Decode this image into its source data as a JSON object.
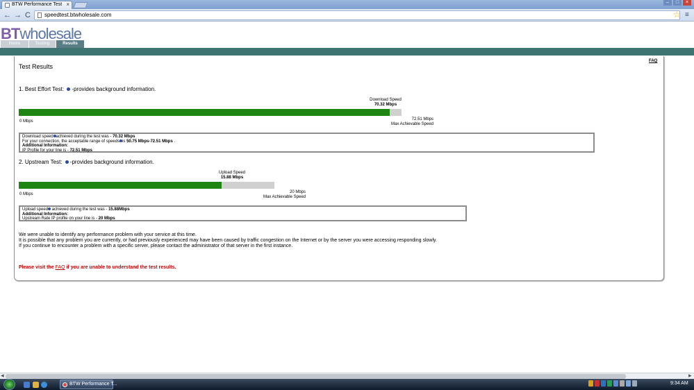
{
  "browser": {
    "tab_title": "BTW Performance Test",
    "tab_close": "×",
    "url": "speedtest.btwholesale.com",
    "back": "←",
    "forward": "→",
    "reload": "C",
    "star": "☆",
    "wrench": "≡",
    "win_buttons": [
      "–",
      "□",
      "×"
    ]
  },
  "site": {
    "logo_bt": "BT",
    "logo_wholesale": "wholesale",
    "tabs": [
      "Home",
      "Testing",
      "Results"
    ],
    "faq_link": "FAQ"
  },
  "results": {
    "title": "Test Results",
    "best_effort": {
      "heading_prefix": "1. Best Effort Test:",
      "heading_suffix": "-provides background information.",
      "speed_caption": "Download Speed",
      "speed_value": "70.32 Mbps",
      "zero_label": "0 Mbps",
      "max_value": "72.51 Mbps",
      "max_caption": "Max Achievable Speed",
      "fraction": 0.9698,
      "info_line1_prefix": "Download speed",
      "info_line1_mid": "achieved during the test was - ",
      "info_line1_value": "70.32 Mbps",
      "info_line2_prefix": "For your connection, the acceptable range of speeds",
      "info_line2_mid": "is ",
      "info_line2_value": "50.75 Mbps-72.51 Mbps",
      "info_line2_suffix": " .",
      "info_line3": "Additional Information:",
      "info_line4_prefix": "IP Profile for your line is - ",
      "info_line4_value": "72.51 Mbps"
    },
    "upstream": {
      "heading_prefix": "2. Upstream Test:",
      "heading_suffix": "-provides background information.",
      "speed_caption": "Upload Speed",
      "speed_value": "15.88 Mbps",
      "zero_label": "0 Mbps",
      "max_value": "20 Mbps",
      "max_caption": "Max Achievable Speed",
      "fraction": 0.794,
      "info_line1_prefix": "Upload speed",
      "info_line1_mid": " achieved during the test was - ",
      "info_line1_value": "15.88Mbps",
      "info_line2": "Additional Information:",
      "info_line3_prefix": "Upstream Rate IP profile on your line is - ",
      "info_line3_value": "20 Mbps"
    },
    "summary": [
      "We were unable to identify any performance problem with your service at this time.",
      "It is possible that any problem you are currently, or had previously experienced may have been caused by traffic congestion on the Internet or by the server you were accessing responding slowly.",
      "If you continue to encounter a problem with a specific server, please contact the administrator of that server in the first instance."
    ],
    "visit_prefix": "Please visit the ",
    "visit_link": "FAQ",
    "visit_suffix": " if you are unable to understand the test results."
  },
  "taskbar": {
    "task_label": "BTW Performance T...",
    "clock": "9:34 AM"
  },
  "colors": {
    "bar_fill": "#1e8412",
    "bar_track": "#d0d0d0",
    "header_band": "#3d7370",
    "warning_text": "#c00000"
  }
}
